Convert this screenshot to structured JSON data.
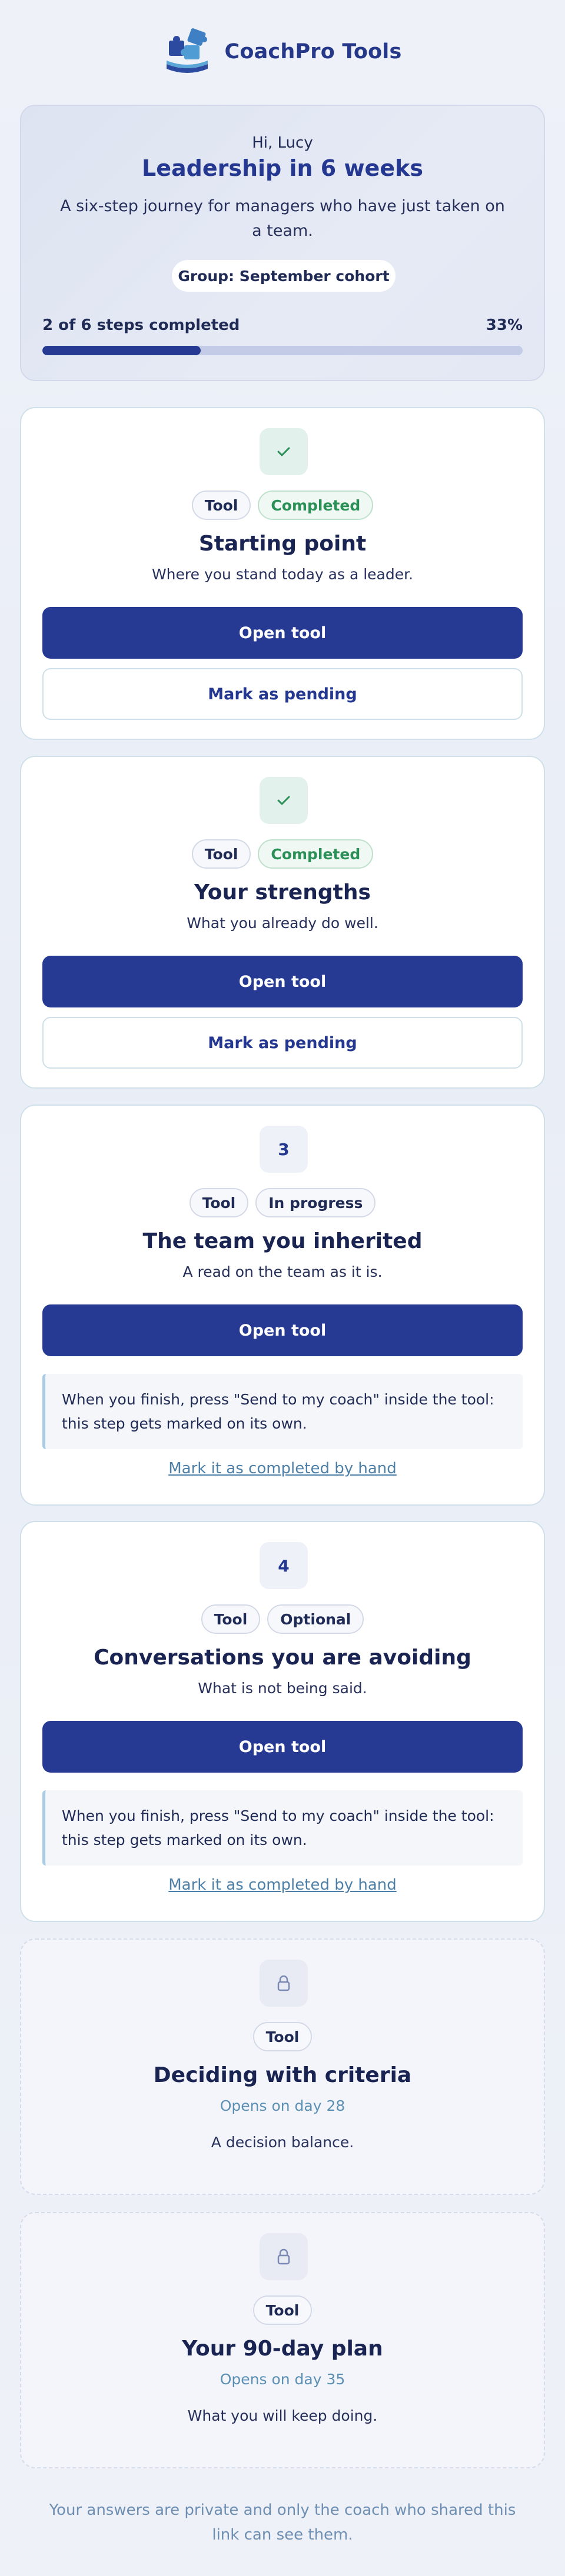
{
  "brand": {
    "name": "CoachPro Tools",
    "logo_icon": "puzzle-logo-icon"
  },
  "intro": {
    "greeting": "Hi, Lucy",
    "title": "Leadership in 6 weeks",
    "description": "A six-step journey for managers who have just taken on a team.",
    "group": "Group: September cohort",
    "progress_label": "2 of 6 steps completed",
    "progress_percent": "33%",
    "progress_value": 33
  },
  "steps": [
    {
      "badge": "check-icon",
      "tags": [
        "Tool",
        "Completed"
      ],
      "title": "Starting point",
      "subtitle": "Where you stand today as a leader.",
      "primary": "Open tool",
      "secondary": "Mark as pending"
    },
    {
      "badge": "check-icon",
      "tags": [
        "Tool",
        "Completed"
      ],
      "title": "Your strengths",
      "subtitle": "What you already do well.",
      "primary": "Open tool",
      "secondary": "Mark as pending"
    },
    {
      "badge": "3",
      "tags": [
        "Tool",
        "In progress"
      ],
      "title": "The team you inherited",
      "subtitle": "A read on the team as it is.",
      "primary": "Open tool",
      "note": "When you finish, press \"Send to my coach\" inside the tool: this step gets marked on its own.",
      "link": "Mark it as completed by hand"
    },
    {
      "badge": "4",
      "tags": [
        "Tool",
        "Optional"
      ],
      "title": "Conversations you are avoiding",
      "subtitle": "What is not being said.",
      "primary": "Open tool",
      "note": "When you finish, press \"Send to my coach\" inside the tool: this step gets marked on its own.",
      "link": "Mark it as completed by hand"
    },
    {
      "badge": "lock-icon",
      "tags": [
        "Tool"
      ],
      "title": "Deciding with criteria",
      "opens": "Opens on day 28",
      "description": "A decision balance."
    },
    {
      "badge": "lock-icon",
      "tags": [
        "Tool"
      ],
      "title": "Your 90-day plan",
      "opens": "Opens on day 35",
      "description": "What you will keep doing."
    }
  ],
  "footer": "Your answers are private and only the coach who shared this link can see them.",
  "colors": {
    "primary": "#263a93",
    "success": "#2b8f58",
    "link": "#4d7fa7",
    "background": "#eef1f8"
  }
}
